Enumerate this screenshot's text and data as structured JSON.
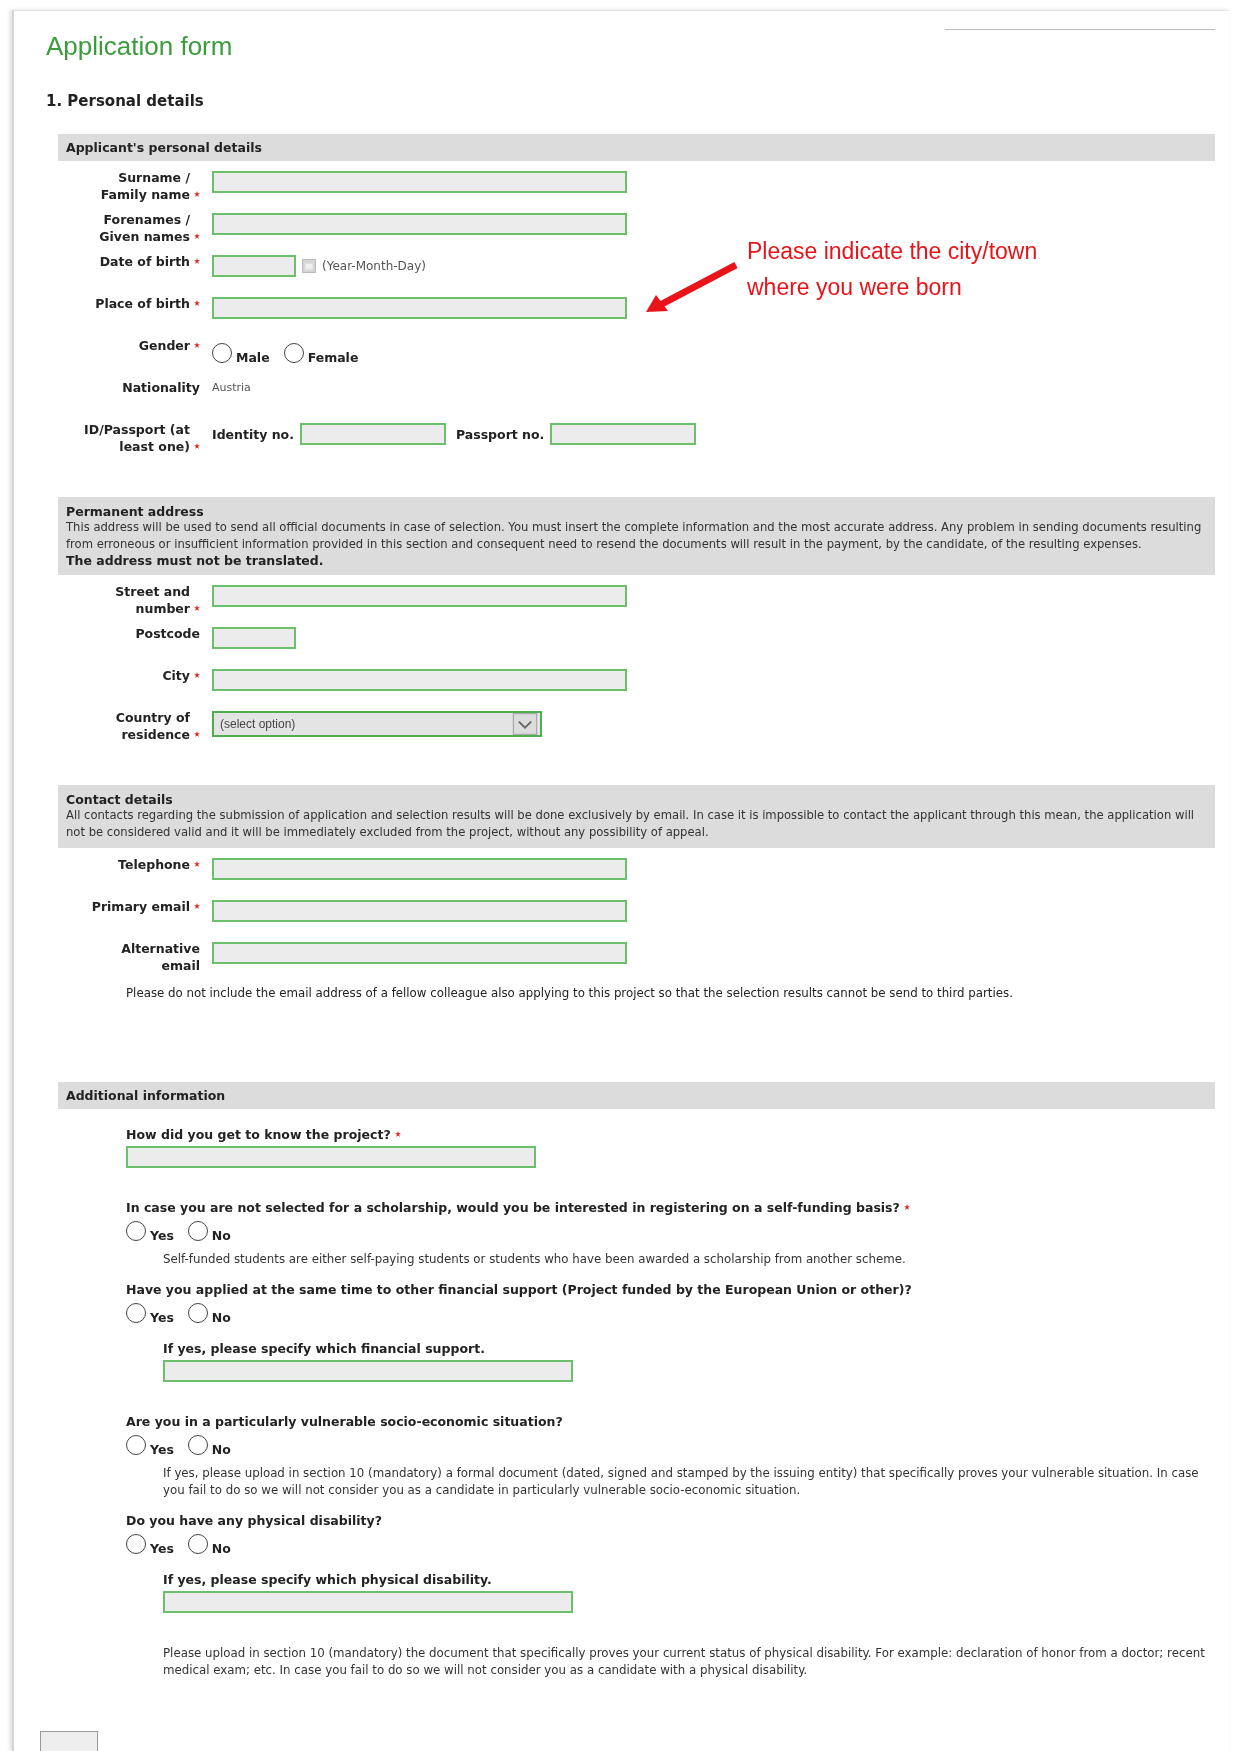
{
  "title": "Application form",
  "section_heading": "1. Personal details",
  "annotation": {
    "lines": [
      "Please indicate the city/town",
      "where you were born"
    ]
  },
  "personal": {
    "heading": "Applicant's personal details",
    "rows": [
      {
        "kind": "text",
        "label": "Surname / Family name",
        "required": true
      },
      {
        "kind": "text",
        "label": "Forenames / Given names",
        "required": true
      },
      {
        "kind": "date",
        "label": "Date of birth",
        "required": true,
        "hint": "(Year-Month-Day)"
      },
      {
        "kind": "text",
        "label": "Place of birth",
        "required": true
      },
      {
        "kind": "radio",
        "label": "Gender",
        "required": true,
        "options": [
          {
            "label": "Male",
            "selected": false
          },
          {
            "label": "Female",
            "selected": false
          }
        ]
      },
      {
        "kind": "static",
        "label": "Nationality",
        "required": false,
        "value": "Austria"
      },
      {
        "kind": "pair",
        "label": "ID/Passport (at least one)",
        "required": true,
        "parts": [
          "Identity no.",
          "Passport no."
        ]
      }
    ]
  },
  "address": {
    "heading": "Permanent address",
    "description": "This address will be used to send all official documents in case of selection. You must insert the complete information and the most accurate address. Any problem in sending documents resulting from erroneous or insufficient information provided in this section and consequent need to resend the documents will result in the payment, by the candidate, of the resulting expenses.",
    "note": "The address must not be translated.",
    "rows": [
      {
        "kind": "text",
        "label": "Street and number",
        "required": true
      },
      {
        "kind": "short",
        "label": "Postcode",
        "required": false
      },
      {
        "kind": "text",
        "label": "City",
        "required": true
      },
      {
        "kind": "select",
        "label": "Country of residence",
        "required": true,
        "value": "(select option)"
      }
    ]
  },
  "contact": {
    "heading": "Contact details",
    "description": "All contacts regarding the submission of application and selection results will be done exclusively by email. In case it is impossible to contact the applicant through this mean, the application will not be considered valid and it will be immediately excluded from the project, without any possibility of appeal.",
    "rows": [
      {
        "kind": "text",
        "label": "Telephone",
        "required": true
      },
      {
        "kind": "text",
        "label": "Primary email",
        "required": true
      },
      {
        "kind": "text",
        "label": "Alternative email",
        "required": false
      }
    ],
    "footnote": "Please do not include the email address of a fellow colleague also applying to this project so that the selection results cannot be send to third parties."
  },
  "additional": {
    "heading": "Additional information",
    "items": [
      {
        "kind": "question",
        "text": "How did you get to know the project?",
        "required": true
      },
      {
        "kind": "field"
      },
      {
        "kind": "question",
        "text": "In case you are not selected for a scholarship, would you be interested in registering on a self-funding basis?",
        "required": true
      },
      {
        "kind": "radio",
        "options": [
          {
            "label": "Yes",
            "selected": false
          },
          {
            "label": "No",
            "selected": false
          }
        ]
      },
      {
        "kind": "note",
        "text": "Self-funded students are either self-paying students or students who have been awarded a scholarship from another scheme."
      },
      {
        "kind": "question",
        "text": "Have you applied at the same time to other financial support (Project funded by the European Union or other)?",
        "required": false
      },
      {
        "kind": "radio",
        "options": [
          {
            "label": "Yes",
            "selected": false
          },
          {
            "label": "No",
            "selected": false
          }
        ]
      },
      {
        "kind": "subquestion",
        "text": "If yes, please specify which financial support."
      },
      {
        "kind": "subfield"
      },
      {
        "kind": "question",
        "text": "Are you in a particularly vulnerable socio-economic situation?",
        "required": false
      },
      {
        "kind": "radio",
        "options": [
          {
            "label": "Yes",
            "selected": false
          },
          {
            "label": "No",
            "selected": false
          }
        ]
      },
      {
        "kind": "note",
        "text": "If yes, please upload in section 10 (mandatory) a formal document (dated, signed and stamped by the issuing entity) that specifically proves your vulnerable situation. In case you fail to do so we will not consider you as a candidate in particularly vulnerable socio-economic situation."
      },
      {
        "kind": "question",
        "text": "Do you have any physical disability?",
        "required": false
      },
      {
        "kind": "radio",
        "options": [
          {
            "label": "Yes",
            "selected": false
          },
          {
            "label": "No",
            "selected": false
          }
        ]
      },
      {
        "kind": "subquestion",
        "text": "If yes, please specify which physical disability."
      },
      {
        "kind": "subfield"
      },
      {
        "kind": "note",
        "text": "Please upload in section 10 (mandatory) the document that specifically proves your current status of physical disability. For example: declaration of honor from a doctor; recent medical exam; etc. In case you fail to do so we will not consider you as a candidate with a physical disability."
      }
    ]
  }
}
